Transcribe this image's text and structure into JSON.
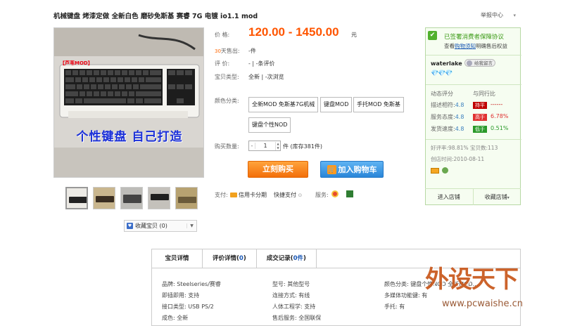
{
  "title": "机械键盘 烤漆定做 全新白色 磨砂免斯基 赛睿 7G 电镀 io1.1 mod",
  "report": "举报中心",
  "gallery": {
    "stamp": "【芦苇MOD】",
    "slogan": "个性键盘    自己打造",
    "favorite_label": "收藏宝贝 (0)"
  },
  "info": {
    "price_label": "价    格:",
    "price": "120.00 - 1450.00",
    "price_unit": "元",
    "sold_prefix": "30",
    "sold_label": "天售出:",
    "sold_value": "-件",
    "rating_label": "评    价:",
    "rating_value": "-  |  -条评价",
    "type_label": "宝贝类型:",
    "type_value": "全新  |  -次浏览",
    "color_label": "颜色分类:",
    "options": [
      "全新MOD 免斯基7G机械",
      "键盘MOD",
      "手托MOD 免斯基",
      "键盘个性NOD"
    ],
    "qty_label": "购买数量:",
    "qty_value": "1",
    "stock": "件 (库存381件)",
    "buy_now": "立刻购买",
    "add_cart": "加入购物车",
    "pay_label": "支付:",
    "pay_credit": "信用卡分期",
    "pay_quick": "快捷支付",
    "service_label": "服务:"
  },
  "seller": {
    "guarantee_title": "已签署消费者保障协议",
    "guarantee_text_1": "查看",
    "guarantee_link": "购物须知",
    "guarantee_text_2": "明确售后权益",
    "name": "waterlake",
    "wangwang": "给我留言",
    "diamonds": "💎💎💎",
    "dsr_title": "动态评分",
    "dsr_compare": "与同行比",
    "dsr": [
      {
        "label": "描述相符:",
        "score": "4.8",
        "tag": "持平",
        "compare": "------",
        "color": "#c00000",
        "cmp_color": "#c00000"
      },
      {
        "label": "服务态度:",
        "score": "4.8",
        "tag": "高于",
        "compare": "6.78%",
        "color": "#e03030",
        "cmp_color": "#e03030"
      },
      {
        "label": "发货速度:",
        "score": "4.8",
        "tag": "低于",
        "compare": "0.51%",
        "color": "#2a9a2a",
        "cmp_color": "#2a9a2a"
      }
    ],
    "praise": "好评率:98.81%  宝贝数:113",
    "created": "创店时间:2010-08-11",
    "enter_shop": "进入店铺",
    "favorite_shop": "收藏店铺"
  },
  "detail": {
    "tabs": [
      {
        "label": "宝贝详情",
        "count": ""
      },
      {
        "label": "评价详情",
        "count": "0"
      },
      {
        "label": "成交记录",
        "count": "0件"
      }
    ],
    "attributes": [
      "品牌: Steelseries/赛睿",
      "型号: 其他型号",
      "颜色分类: 键盘个性NOD 全新MOD…",
      "即插即用: 支持",
      "连接方式: 有线",
      "多媒体功能键: 有",
      "接口类型: USB PS/2",
      "人体工程学: 支持",
      "手托: 有",
      "成色: 全新",
      "售后服务: 全国联保"
    ]
  },
  "watermark": {
    "logo": "外设天下",
    "url": "www.pcwaishe.cn"
  },
  "colors": {
    "price": "#ff5500",
    "buy": "#f36f0a",
    "cart": "#2a86d8",
    "seller_border": "#b7d8a4"
  }
}
